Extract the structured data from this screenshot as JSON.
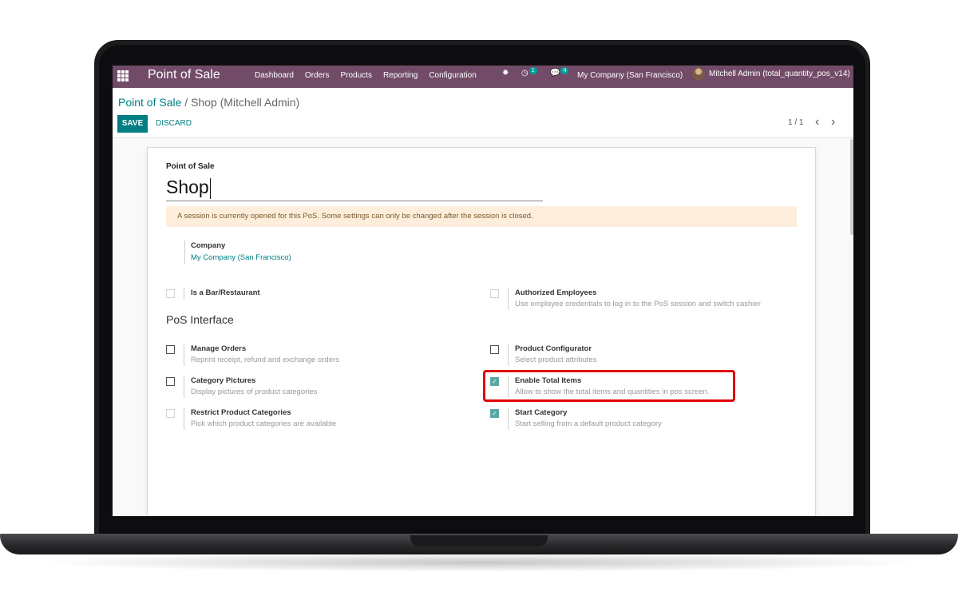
{
  "navbar": {
    "app_name": "Point of Sale",
    "menu": [
      "Dashboard",
      "Orders",
      "Products",
      "Reporting",
      "Configuration"
    ],
    "activity_count": "1",
    "messages_count": "4",
    "company": "My Company (San Francisco)",
    "user": "Mitchell Admin (total_quantity_pos_v14)",
    "color": "#714b67"
  },
  "breadcrumb": {
    "parent": "Point of Sale",
    "separator": "/",
    "current": "Shop (Mitchell Admin)"
  },
  "buttons": {
    "save": "SAVE",
    "discard": "DISCARD"
  },
  "pager": {
    "value": "1 / 1"
  },
  "form": {
    "name_label": "Point of Sale",
    "name_value": "Shop",
    "alert": "A session is currently opened for this PoS. Some settings can only be changed after the session is closed.",
    "company_label": "Company",
    "company_value": "My Company (San Francisco)",
    "bar_restaurant": {
      "label": "Is a Bar/Restaurant",
      "checked": false
    },
    "authorized_employees": {
      "label": "Authorized Employees",
      "help": "Use employee credentials to log in to the PoS session and switch cashier",
      "checked": false
    },
    "section_title": "PoS Interface",
    "manage_orders": {
      "label": "Manage Orders",
      "help": "Reprint receipt, refund and exchange orders",
      "checked": false
    },
    "product_configurator": {
      "label": "Product Configurator",
      "help": "Select product attributes",
      "checked": false
    },
    "category_pictures": {
      "label": "Category Pictures",
      "help": "Display pictures of product categories",
      "checked": false
    },
    "enable_total_items": {
      "label": "Enable Total Items",
      "help": "Allow to show the total items and quantities in pos screen.",
      "checked": true
    },
    "restrict_categories": {
      "label": "Restrict Product Categories",
      "help": "Pick which product categories are available",
      "checked": false
    },
    "start_category": {
      "label": "Start Category",
      "help": "Start selling from a default product category",
      "checked": true
    }
  },
  "colors": {
    "accent": "#017e84",
    "highlight": "#e00000",
    "alert_bg": "#fdeedc"
  }
}
